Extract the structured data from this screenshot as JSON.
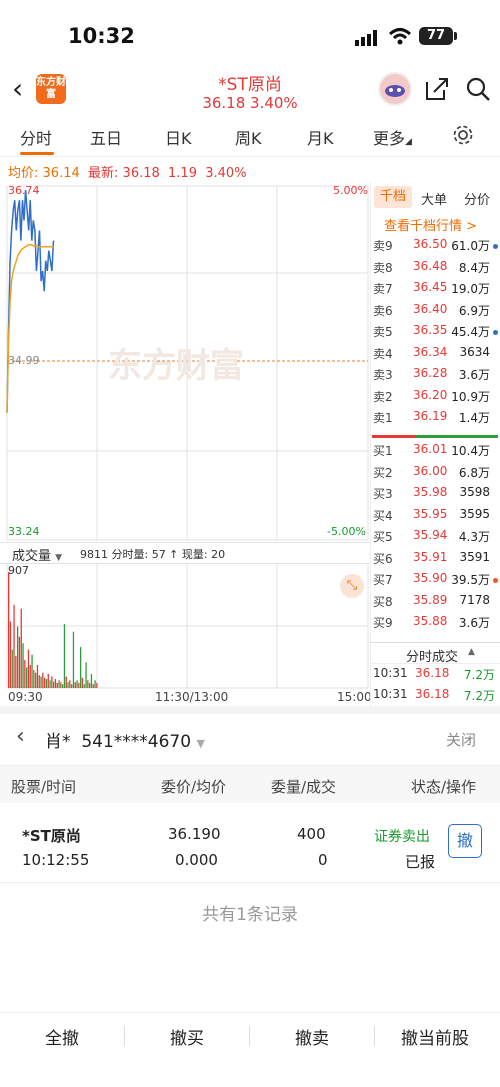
{
  "status_bar": {
    "time": "10:32",
    "battery": "77"
  },
  "header": {
    "logo_text": "东方财富",
    "stock_name": "*ST原尚",
    "stock_price_line": "36.18  3.40%"
  },
  "tabs": [
    {
      "label": "分时"
    },
    {
      "label": "五日"
    },
    {
      "label": "日K"
    },
    {
      "label": "周K"
    },
    {
      "label": "月K"
    },
    {
      "label": "更多"
    }
  ],
  "info": {
    "avg_label": "均价:",
    "avg_value": "36.14",
    "latest_label": "最新:",
    "latest_value": "36.18",
    "change": "1.19",
    "change_pct": "3.40%"
  },
  "chart_data": {
    "type": "line",
    "y_high": "36.74",
    "y_mid": "34.99",
    "y_low": "33.24",
    "pct_high": "5.00%",
    "pct_low": "-5.00%",
    "x_labels": [
      "09:30",
      "11:30/13:00",
      "15:00"
    ],
    "ylim": [
      33.24,
      36.74
    ],
    "prev_close": 34.99,
    "series": [
      {
        "values": [
          34.5,
          35.3,
          36.0,
          36.3,
          36.5,
          36.6,
          36.3,
          36.5,
          36.6,
          36.2,
          36.6,
          36.4,
          36.7,
          36.5,
          36.3,
          36.6,
          36.2,
          36.4,
          36.3,
          35.9,
          36.1,
          36.3,
          35.8,
          35.9,
          35.7,
          36.0,
          35.9,
          36.1,
          36.0,
          35.9,
          36.2
        ]
      },
      {
        "values": [
          34.5,
          35.2,
          35.6,
          35.8,
          35.9,
          35.95,
          36.0,
          36.05,
          36.08,
          36.1,
          36.12,
          36.13,
          36.14,
          36.15,
          36.16,
          36.16,
          36.16,
          36.15,
          36.15,
          36.15,
          36.14,
          36.14,
          36.14,
          36.14,
          36.14,
          36.14,
          36.14,
          36.14,
          36.14,
          36.14,
          36.14
        ]
      }
    ],
    "volume": {
      "label": "成交量",
      "stats": "9811 分时量: 57 ↑ 现量: 20",
      "max": "907",
      "bars": [
        907,
        520,
        300,
        650,
        250,
        480,
        400,
        620,
        350,
        220,
        160,
        300,
        180,
        260,
        140,
        120,
        180,
        100,
        90,
        120,
        80,
        70,
        110,
        60,
        90,
        50,
        70,
        40,
        60,
        45,
        30,
        500,
        90,
        45,
        60,
        30,
        440,
        45,
        60,
        40,
        320,
        80,
        30,
        200,
        60,
        40,
        110,
        30,
        60,
        40
      ],
      "bar_colors": [
        "r",
        "r",
        "g",
        "r",
        "r",
        "g",
        "r",
        "r",
        "g",
        "r",
        "g",
        "r",
        "r",
        "g",
        "r",
        "g",
        "r",
        "r",
        "g",
        "r",
        "r",
        "g",
        "r",
        "g",
        "r",
        "g",
        "r",
        "r",
        "g",
        "r",
        "g",
        "g",
        "r",
        "g",
        "r",
        "g",
        "g",
        "r",
        "g",
        "r",
        "g",
        "r",
        "g",
        "g",
        "r",
        "g",
        "g",
        "r",
        "g",
        "r"
      ]
    }
  },
  "orderbook": {
    "tab_active": "千档",
    "tab2": "大单",
    "tab3": "分价",
    "link": "查看千档行情 >",
    "asks": [
      {
        "lvl": "卖9",
        "price": "36.50",
        "vol": "61.0万",
        "dot": "#2d6fc9"
      },
      {
        "lvl": "卖8",
        "price": "36.48",
        "vol": "8.4万",
        "dot": ""
      },
      {
        "lvl": "卖7",
        "price": "36.45",
        "vol": "19.0万",
        "dot": ""
      },
      {
        "lvl": "卖6",
        "price": "36.40",
        "vol": "6.9万",
        "dot": ""
      },
      {
        "lvl": "卖5",
        "price": "36.35",
        "vol": "45.4万",
        "dot": "#2d6fc9"
      },
      {
        "lvl": "卖4",
        "price": "36.34",
        "vol": "3634",
        "dot": ""
      },
      {
        "lvl": "卖3",
        "price": "36.28",
        "vol": "3.6万",
        "dot": ""
      },
      {
        "lvl": "卖2",
        "price": "36.20",
        "vol": "10.9万",
        "dot": ""
      },
      {
        "lvl": "卖1",
        "price": "36.19",
        "vol": "1.4万",
        "dot": ""
      }
    ],
    "bids": [
      {
        "lvl": "买1",
        "price": "36.01",
        "vol": "10.4万",
        "dot": ""
      },
      {
        "lvl": "买2",
        "price": "36.00",
        "vol": "6.8万",
        "dot": ""
      },
      {
        "lvl": "买3",
        "price": "35.98",
        "vol": "3598",
        "dot": ""
      },
      {
        "lvl": "买4",
        "price": "35.95",
        "vol": "3595",
        "dot": ""
      },
      {
        "lvl": "买5",
        "price": "35.94",
        "vol": "4.3万",
        "dot": ""
      },
      {
        "lvl": "买6",
        "price": "35.91",
        "vol": "3591",
        "dot": ""
      },
      {
        "lvl": "买7",
        "price": "35.90",
        "vol": "39.5万",
        "dot": "#e85a1b"
      },
      {
        "lvl": "买8",
        "price": "35.89",
        "vol": "7178",
        "dot": ""
      },
      {
        "lvl": "买9",
        "price": "35.88",
        "vol": "3.6万",
        "dot": ""
      }
    ],
    "ticks_label": "分时成交",
    "ticks": [
      {
        "time": "10:31",
        "price": "36.18",
        "vol": "7.2万"
      },
      {
        "time": "10:31",
        "price": "36.18",
        "vol": "7.2万"
      }
    ]
  },
  "account": {
    "name": "肖*",
    "number": "541****4670",
    "close": "关闭"
  },
  "table": {
    "headers": [
      "股票/时间",
      "委价/均价",
      "委量/成交",
      "状态/操作"
    ],
    "row": {
      "stock": "*ST原尚",
      "time": "10:12:55",
      "price": "36.190",
      "avg": "0.000",
      "qty": "400",
      "filled": "0",
      "status": "证券卖出",
      "state": "已报",
      "cancel": "撤"
    },
    "footer": "共有1条记录"
  },
  "bottom_buttons": [
    "全撤",
    "撤买",
    "撤卖",
    "撤当前股"
  ]
}
